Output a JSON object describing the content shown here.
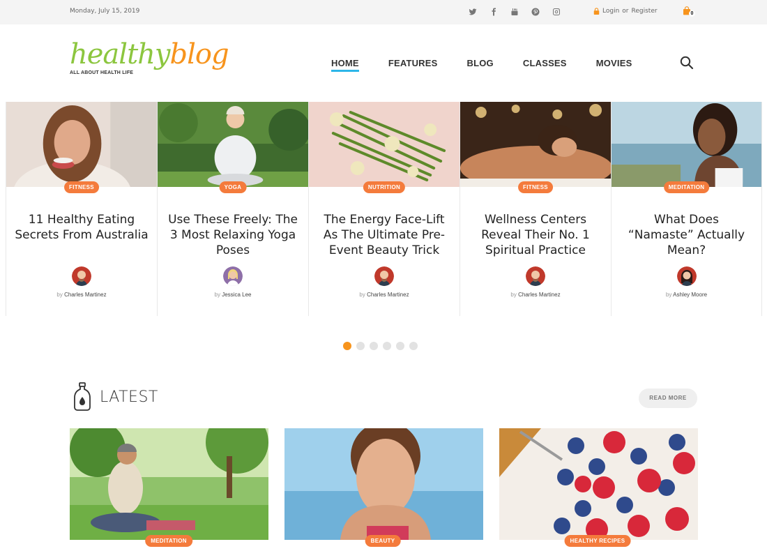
{
  "topbar": {
    "date": "Monday, July 15, 2019",
    "social": [
      "twitter-icon",
      "facebook-icon",
      "youtube-icon",
      "pinterest-icon",
      "instagram-icon"
    ],
    "login": "Login",
    "or": "or",
    "register": "Register",
    "cart_count": "0"
  },
  "header": {
    "logo_part1": "healthy",
    "logo_part2": "blog",
    "tagline": "ALL ABOUT HEALTH LIFE",
    "nav": [
      "HOME",
      "FEATURES",
      "BLOG",
      "CLASSES",
      "MOVIES"
    ],
    "active_nav": "HOME"
  },
  "slider": {
    "cards": [
      {
        "category": "FITNESS",
        "title": "11 Healthy Eating Secrets From Australia",
        "by": "by",
        "author": "Charles Martinez"
      },
      {
        "category": "YOGA",
        "title": "Use These Freely: The 3 Most Relaxing Yoga Poses",
        "by": "by",
        "author": "Jessica Lee"
      },
      {
        "category": "NUTRITION",
        "title": "The Energy Face-Lift As The Ultimate Pre-Event Beauty Trick",
        "by": "by",
        "author": "Charles Martinez"
      },
      {
        "category": "FITNESS",
        "title": "Wellness Centers Reveal Their No. 1 Spiritual Practice",
        "by": "by",
        "author": "Charles Martinez"
      },
      {
        "category": "MEDITATION",
        "title": "What Does “Namaste” Actually Mean?",
        "by": "by",
        "author": "Ashley Moore"
      }
    ],
    "dots_total": 6,
    "dots_active": 1
  },
  "latest": {
    "title": "LATEST",
    "read_more": "READ MORE",
    "cards": [
      {
        "category": "MEDITATION"
      },
      {
        "category": "BEAUTY"
      },
      {
        "category": "HEALTHY RECIPES"
      }
    ]
  },
  "colors": {
    "accent": "#f47b3c",
    "logo_green": "#8cc63f",
    "logo_orange": "#f7941d",
    "nav_underline": "#2db6e8"
  }
}
